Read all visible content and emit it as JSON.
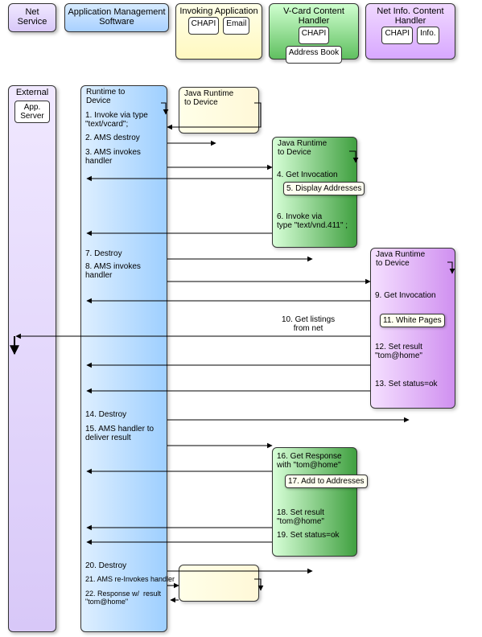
{
  "lanes": {
    "net_service": {
      "title": "Net\nService"
    },
    "ams": {
      "title": "Application\nManagement Software"
    },
    "invoking": {
      "title": "Invoking\nApplication",
      "sub1": "CHAPI",
      "sub2": "Email"
    },
    "vcard": {
      "title": "V-Card\nContent Handler",
      "sub1": "CHAPI",
      "sub2": "Address\nBook"
    },
    "netinfo": {
      "title": "Net Info.\nContent Handler",
      "sub1": "CHAPI",
      "sub2": "Info."
    },
    "external": {
      "title": "External",
      "sub": "App.\nServer"
    }
  },
  "runtimes": {
    "ams": "Runtime to\nDevice",
    "invoking": "Java Runtime\nto Device",
    "vcard": "Java Runtime\nto Device",
    "netinfo": "Java Runtime\nto Device"
  },
  "steps": {
    "s1": "1. Invoke via type\n\"text/vcard\";",
    "s2": "2. AMS destroy",
    "s3": "3. AMS invokes\nhandler",
    "s4": "4. Get Invocation",
    "s5": "5.  Display\nAddresses",
    "s6": "6. Invoke via\ntype \"text/vnd.411\" ;",
    "s7": "7. Destroy",
    "s8": "8. AMS invokes\nhandler",
    "s9": "9. Get Invocation",
    "s10": "10. Get listings\nfrom net",
    "s11": "11. White Pages",
    "s12": "12. Set result\n\"tom@home\"",
    "s13": "13. Set status=ok",
    "s14": "14. Destroy",
    "s15": "15. AMS handler to\ndeliver result",
    "s16": "16. Get Response\nwith \"tom@home\"",
    "s17": "17. Add to\nAddresses",
    "s18": "18. Set result\n\"tom@home\"",
    "s19": "19. Set status=ok",
    "s20": "20. Destroy",
    "s21": "21. AMS re-Invokes handler",
    "s22": "22. Response w/  result\n\"tom@home\""
  },
  "chart_data": {
    "type": "sequence",
    "participants": [
      {
        "id": "external",
        "label": "External / App. Server"
      },
      {
        "id": "ams",
        "label": "Application Management Software"
      },
      {
        "id": "invoking",
        "label": "Invoking Application (CHAPI, Email)"
      },
      {
        "id": "vcard",
        "label": "V-Card Content Handler (CHAPI, Address Book)"
      },
      {
        "id": "netinfo",
        "label": "Net Info. Content Handler (CHAPI, Info.)"
      }
    ],
    "messages": [
      {
        "n": 1,
        "from": "invoking",
        "to": "ams",
        "text": "Invoke via type \"text/vcard\";"
      },
      {
        "n": 2,
        "from": "ams",
        "to": "invoking",
        "text": "AMS destroy"
      },
      {
        "n": 3,
        "from": "ams",
        "to": "vcard",
        "text": "AMS invokes handler"
      },
      {
        "n": 4,
        "from": "vcard",
        "to": "vcard",
        "text": "Get Invocation"
      },
      {
        "n": 5,
        "from": "vcard",
        "to": "vcard",
        "text": "Display Addresses"
      },
      {
        "n": 6,
        "from": "vcard",
        "to": "ams",
        "text": "Invoke via type \"text/vnd.411\" ;"
      },
      {
        "n": 7,
        "from": "ams",
        "to": "vcard",
        "text": "Destroy"
      },
      {
        "n": 8,
        "from": "ams",
        "to": "netinfo",
        "text": "AMS invokes handler"
      },
      {
        "n": 9,
        "from": "netinfo",
        "to": "netinfo",
        "text": "Get Invocation"
      },
      {
        "n": 10,
        "from": "netinfo",
        "to": "external",
        "text": "Get listings from net"
      },
      {
        "n": 11,
        "from": "netinfo",
        "to": "netinfo",
        "text": "White Pages"
      },
      {
        "n": 12,
        "from": "netinfo",
        "to": "netinfo",
        "text": "Set result \"tom@home\""
      },
      {
        "n": 13,
        "from": "netinfo",
        "to": "ams",
        "text": "Set status=ok"
      },
      {
        "n": 14,
        "from": "ams",
        "to": "netinfo",
        "text": "Destroy"
      },
      {
        "n": 15,
        "from": "ams",
        "to": "vcard",
        "text": "AMS handler to deliver result"
      },
      {
        "n": 16,
        "from": "vcard",
        "to": "vcard",
        "text": "Get Response with \"tom@home\""
      },
      {
        "n": 17,
        "from": "vcard",
        "to": "vcard",
        "text": "Add to Addresses"
      },
      {
        "n": 18,
        "from": "vcard",
        "to": "vcard",
        "text": "Set result \"tom@home\""
      },
      {
        "n": 19,
        "from": "vcard",
        "to": "ams",
        "text": "Set status=ok"
      },
      {
        "n": 20,
        "from": "ams",
        "to": "vcard",
        "text": "Destroy"
      },
      {
        "n": 21,
        "from": "ams",
        "to": "invoking",
        "text": "AMS re-Invokes handler"
      },
      {
        "n": 22,
        "from": "invoking",
        "to": "invoking",
        "text": "Response w/ result \"tom@home\""
      }
    ]
  }
}
